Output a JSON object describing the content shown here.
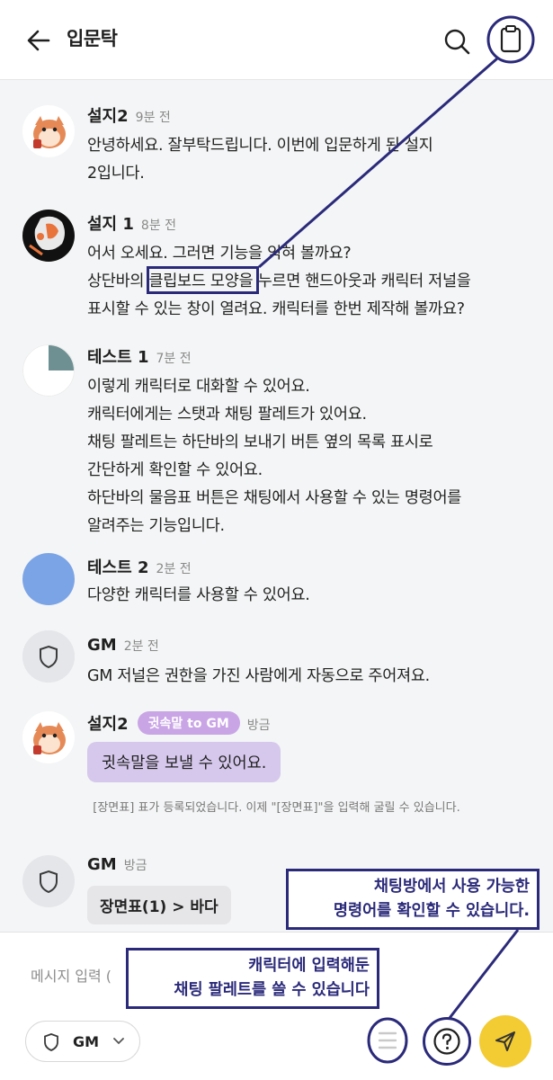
{
  "header": {
    "title": "입문탁",
    "icons": [
      "back-arrow-icon",
      "search-icon",
      "clipboard-icon"
    ]
  },
  "messages": [
    {
      "author": "설지2",
      "time": "9분 전",
      "avatar": "cartoon-mascot",
      "lines": [
        "안녕하세요. 잘부탁드립니다. 이번에 입문하게 된 설지",
        "2입니다."
      ]
    },
    {
      "author": "설지 1",
      "time": "8분 전",
      "avatar": "character-illustration",
      "lines": [
        "어서 오세요. 그러면 기능을 익혀 볼까요?",
        "상단바의 클립보드 모양을 누르면 핸드아웃과 캐릭터 저널을",
        "표시할 수 있는 창이 열려요. 캐릭터를 한번 제작해 볼까요?"
      ]
    },
    {
      "author": "테스트 1",
      "time": "7분 전",
      "avatar": "quarter-pie",
      "lines": [
        "이렇게 캐릭터로 대화할 수 있어요.",
        "캐릭터에게는 스탯과 채팅 팔레트가 있어요.",
        "채팅 팔레트는 하단바의 보내기 버튼 옆의 목록 표시로",
        "간단하게 확인할 수 있어요.",
        "하단바의 물음표 버튼은 채팅에서 사용할 수 있는 명령어를",
        "알려주는 기능입니다."
      ]
    },
    {
      "author": "테스트 2",
      "time": "2분 전",
      "avatar": "blue-circle",
      "lines": [
        "다양한 캐릭터를 사용할 수 있어요."
      ]
    },
    {
      "author": "GM",
      "time": "2분 전",
      "avatar": "shield",
      "lines": [
        "GM 저널은 권한을 가진 사람에게 자동으로 주어져요."
      ]
    },
    {
      "author": "설지2",
      "whisper_badge": "귓속말 to GM",
      "time": "방금",
      "avatar": "cartoon-mascot",
      "bubble": "귓속말을 보낼 수 있어요."
    },
    {
      "author": "GM",
      "time": "방금",
      "avatar": "shield",
      "command": "장면표(1) > 바다"
    }
  ],
  "system_note": "[장면표] 표가 등록되었습니다. 이제 \"[장면표]\"을 입력해 굴릴 수 있습니다.",
  "composer": {
    "placeholder": "메시지 입력 (",
    "character": "GM",
    "icons": [
      "shield-icon",
      "chevron-down-icon",
      "list-icon",
      "question-icon",
      "send-icon"
    ]
  },
  "annotations": {
    "commands_callout": [
      "채팅방에서 사용 가능한",
      "명령어를 확인할 수 있습니다."
    ],
    "palette_callout": [
      "캐릭터에 입력해둔",
      "채팅 팔레트를 쓸 수 있습니다"
    ]
  },
  "colors": {
    "accent_navy": "#2b2a7a",
    "send_yellow": "#f3cb33",
    "whisper_purple": "#c9a5e6",
    "whisper_bubble": "#d6c8ec",
    "chat_bg": "#f4f5f6"
  }
}
